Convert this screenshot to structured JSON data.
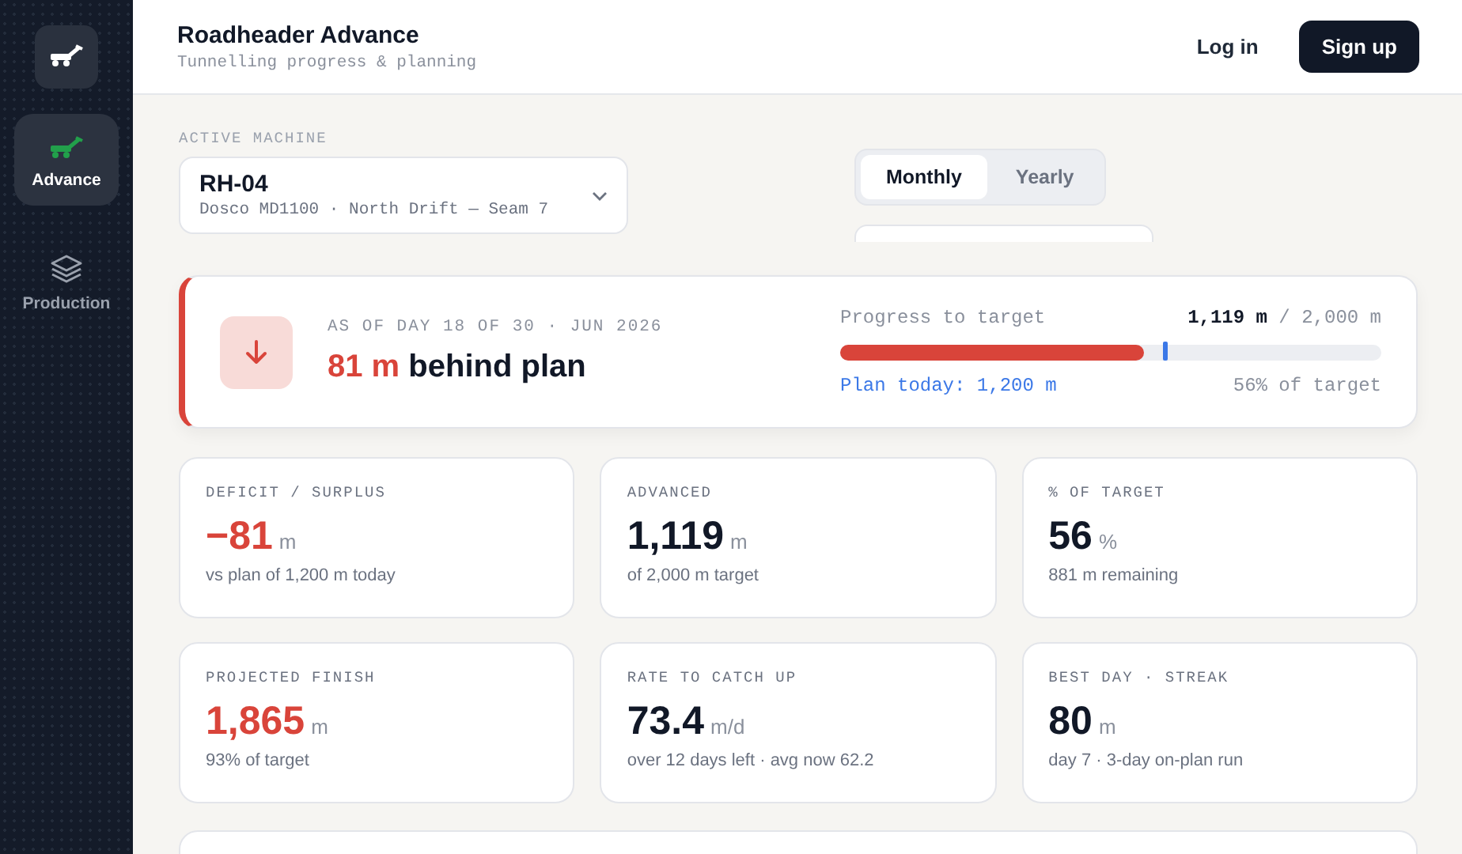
{
  "sidebar": {
    "items": [
      {
        "kind": "logo",
        "selected": false
      },
      {
        "kind": "roadheader",
        "label": "Advance",
        "selected": true
      },
      {
        "kind": "layers",
        "label": "Production",
        "selected": false
      }
    ]
  },
  "header": {
    "title": "Roadheader Advance",
    "subtitle": "Tunnelling progress & planning",
    "buttons": [
      {
        "label": "Log in",
        "kind": "ghost"
      },
      {
        "label": "Sign up",
        "kind": "primary"
      }
    ]
  },
  "machine": {
    "label": "ACTIVE MACHINE",
    "name": "RH-04",
    "detail": "Dosco MD1100 · North Drift — Seam 7"
  },
  "period_tabs": [
    {
      "label": "Monthly",
      "selected": true
    },
    {
      "label": "Yearly",
      "selected": false
    }
  ],
  "status": {
    "kind": "negative",
    "date": "AS OF DAY 18 OF 30 · JUN 2026",
    "amount": "81 m",
    "text": "behind plan",
    "progress_label": "Progress to target",
    "progress_value": "**1,119 m** / 2,000 m",
    "level": 0.56,
    "plan_marker": {
      "level": 0.6
    },
    "plan_text": "Plan today: 1,200 m",
    "share_text": "56% of target"
  },
  "stats": [
    {
      "label": "DEFICIT / SURPLUS",
      "value": "−81",
      "unit": "m",
      "note": "vs plan of 1,200 m today",
      "kind": "negative"
    },
    {
      "label": "ADVANCED",
      "value": "1,119",
      "unit": "m",
      "note": "of 2,000 m target",
      "kind": "neutral"
    },
    {
      "label": "% OF TARGET",
      "value": "56",
      "unit": "%",
      "note": "881 m remaining",
      "kind": "neutral"
    },
    {
      "label": "PROJECTED FINISH",
      "value": "1,865",
      "unit": "m",
      "note": "93% of target",
      "kind": "negative"
    },
    {
      "label": "RATE TO CATCH UP",
      "value": "73.4",
      "unit": "m/d",
      "note": "over 12 days left · avg now 62.2",
      "kind": "neutral"
    },
    {
      "label": "BEST DAY · STREAK",
      "value": "80",
      "unit": "m",
      "note": "day 7 · 3-day on-plan run",
      "kind": "neutral"
    }
  ]
}
